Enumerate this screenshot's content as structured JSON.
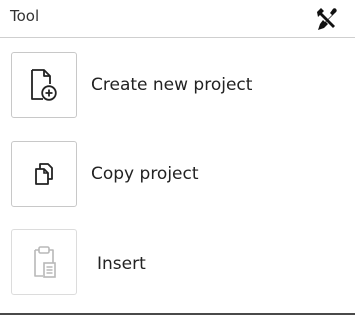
{
  "header": {
    "title": "Tool",
    "icon": "tools-icon"
  },
  "items": [
    {
      "label": "Create new project",
      "icon": "new-file-plus-icon",
      "enabled": true
    },
    {
      "label": "Copy project",
      "icon": "copy-icon",
      "enabled": true
    },
    {
      "label": "Insert",
      "icon": "paste-clipboard-icon",
      "enabled": false
    }
  ],
  "colors": {
    "text": "#222222",
    "border": "#c8c8c8",
    "disabled_icon": "#b8b8b8",
    "divider": "#cfcfcf"
  }
}
